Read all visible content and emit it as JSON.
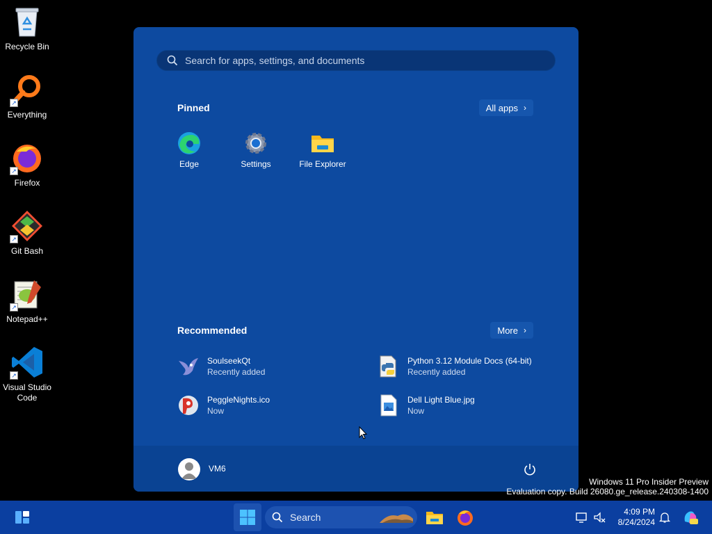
{
  "desktop": {
    "icons": [
      {
        "label": "Recycle Bin",
        "icon": "recycle-bin-icon"
      },
      {
        "label": "Everything",
        "icon": "everything-search-icon"
      },
      {
        "label": "Firefox",
        "icon": "firefox-icon"
      },
      {
        "label": "Git Bash",
        "icon": "git-bash-icon"
      },
      {
        "label": "Notepad++",
        "icon": "notepad-plus-plus-icon"
      },
      {
        "label": "Visual Studio\nCode",
        "icon": "vscode-icon"
      }
    ]
  },
  "start_menu": {
    "search_placeholder": "Search for apps, settings, and documents",
    "pinned_title": "Pinned",
    "all_apps_label": "All apps",
    "pinned": [
      {
        "label": "Edge",
        "icon": "edge-icon"
      },
      {
        "label": "Settings",
        "icon": "settings-gear-icon"
      },
      {
        "label": "File Explorer",
        "icon": "folder-icon"
      }
    ],
    "recommended_title": "Recommended",
    "more_label": "More",
    "recommended": [
      {
        "name": "SoulseekQt",
        "sub": "Recently added",
        "icon": "soulseek-bird-icon"
      },
      {
        "name": "Python 3.12 Module Docs (64-bit)",
        "sub": "Recently added",
        "icon": "python-docs-icon"
      },
      {
        "name": "PeggleNights.ico",
        "sub": "Now",
        "icon": "peggle-icon"
      },
      {
        "name": "Dell Light Blue.jpg",
        "sub": "Now",
        "icon": "image-file-icon"
      }
    ],
    "user_name": "VM6"
  },
  "watermark": {
    "line1": "Windows 11 Pro Insider Preview",
    "line2": "Evaluation copy. Build 26080.ge_release.240308-1400"
  },
  "taskbar": {
    "search_label": "Search",
    "time": "4:09 PM",
    "date": "8/24/2024"
  },
  "colors": {
    "start_bg": "#0d4aa0",
    "taskbar_bg": "#0b3fa0",
    "desktop_bg": "#000000"
  }
}
